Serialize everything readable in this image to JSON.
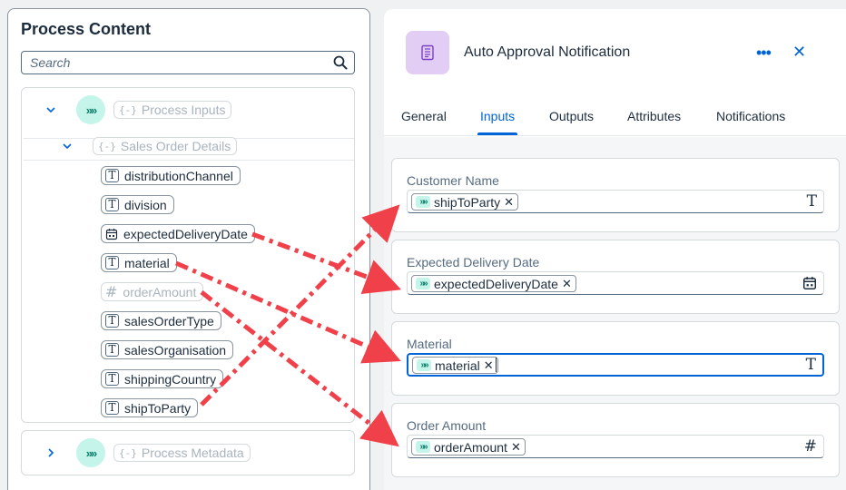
{
  "left_panel": {
    "title": "Process Content",
    "search_placeholder": "Search",
    "process_inputs": "Process Inputs",
    "sales_order_details": "Sales Order Details",
    "process_metadata": "Process Metadata",
    "bubble_glyph": "»»",
    "group_glyph": "{-}",
    "fields": [
      {
        "label": "distributionChannel",
        "type": "text"
      },
      {
        "label": "division",
        "type": "text"
      },
      {
        "label": "expectedDeliveryDate",
        "type": "date"
      },
      {
        "label": "material",
        "type": "text"
      },
      {
        "label": "orderAmount",
        "type": "number"
      },
      {
        "label": "salesOrderType",
        "type": "text"
      },
      {
        "label": "salesOrganisation",
        "type": "text"
      },
      {
        "label": "shippingCountry",
        "type": "text"
      },
      {
        "label": "shipToParty",
        "type": "text"
      }
    ]
  },
  "right_panel": {
    "title": "Auto Approval Notification",
    "more_label": "•••",
    "close_label": "✕",
    "tabs": [
      "General",
      "Inputs",
      "Outputs",
      "Attributes",
      "Notifications"
    ],
    "active_tab": "Inputs",
    "inputs": [
      {
        "label": "Customer Name",
        "token": "shipToParty",
        "type": "text"
      },
      {
        "label": "Expected Delivery Date",
        "token": "expectedDeliveryDate",
        "type": "date"
      },
      {
        "label": "Material",
        "token": "material",
        "type": "text"
      },
      {
        "label": "Order Amount",
        "token": "orderAmount",
        "type": "number"
      }
    ],
    "token_remove": "✕",
    "text_type_glyph": "T",
    "number_type_glyph": "#"
  },
  "colors": {
    "accent": "#0064d9",
    "arrow": "#f0404a",
    "bubble": "#c5f5ea",
    "task_icon_bg": "#e2cdf4"
  }
}
